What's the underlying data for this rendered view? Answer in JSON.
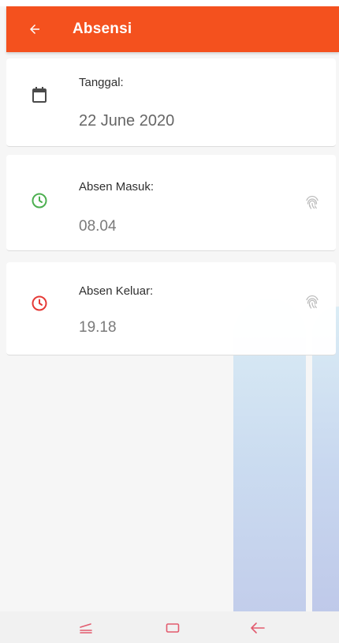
{
  "app_bar": {
    "title": "Absensi",
    "back_icon": "arrow-back-icon",
    "color": "#f4511e"
  },
  "date_card": {
    "icon": "calendar-icon",
    "label": "Tanggal:",
    "value": "22 June 2020"
  },
  "check_in_card": {
    "icon": "clock-icon",
    "icon_color": "#4caf50",
    "label": "Absen Masuk:",
    "value": "08.04",
    "action_icon": "fingerprint-icon"
  },
  "check_out_card": {
    "icon": "clock-icon",
    "icon_color": "#e53935",
    "label": "Absen Keluar:",
    "value": "19.18",
    "action_icon": "fingerprint-icon"
  },
  "nav_bar": {
    "buttons": [
      "recents-icon",
      "home-icon",
      "back-icon"
    ],
    "icon_color": "#e25b6e"
  }
}
